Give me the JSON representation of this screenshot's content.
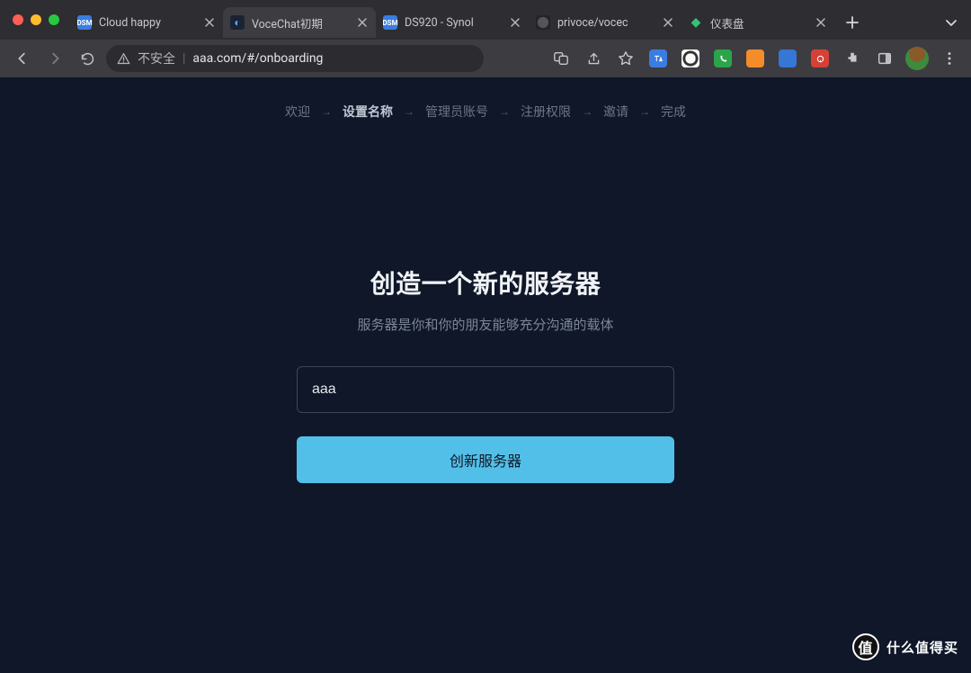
{
  "browser": {
    "tabs": [
      {
        "favicon": "dsm",
        "title": "Cloud happy"
      },
      {
        "favicon": "voce",
        "title": "VoceChat初期"
      },
      {
        "favicon": "dsm",
        "title": "DS920 - Synol"
      },
      {
        "favicon": "gh",
        "title": "privoce/vocec"
      },
      {
        "favicon": "portainer",
        "title": "仪表盘"
      }
    ],
    "active_tab_index": 1,
    "omnibox": {
      "warn_text": "不安全",
      "url": "aaa.com/#/onboarding"
    }
  },
  "onboarding": {
    "steps": [
      "欢迎",
      "设置名称",
      "管理员账号",
      "注册权限",
      "邀请",
      "完成"
    ],
    "current_step_index": 1,
    "title": "创造一个新的服务器",
    "subtitle": "服务器是你和你的朋友能够充分沟通的载体",
    "server_name_value": "aaa",
    "create_button_label": "创新服务器"
  },
  "watermark": "什么值得买"
}
